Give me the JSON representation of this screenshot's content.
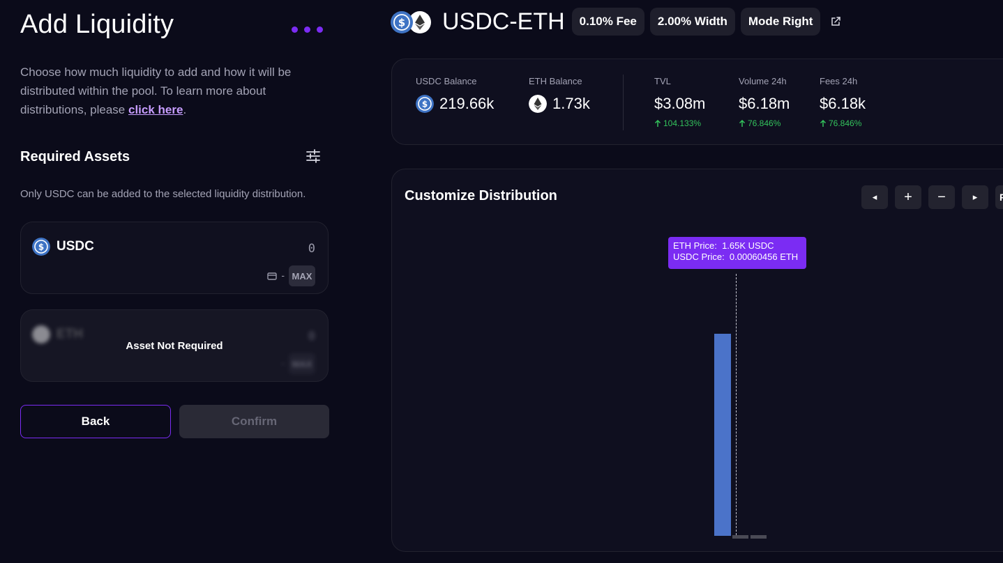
{
  "left": {
    "title": "Add Liquidity",
    "intro_text": "Choose how much liquidity to add and how it will be distributed within the pool. To learn more about distributions, please ",
    "intro_link": "click here",
    "intro_end": ".",
    "section_title": "Required Assets",
    "note": "Only USDC can be added to the selected liquidity distribution.",
    "usdc_card": {
      "symbol": "USDC",
      "amount": "0",
      "wallet_balance": "-",
      "max_label": "MAX"
    },
    "eth_card": {
      "symbol": "ETH",
      "amount": "0",
      "wallet_balance": "-",
      "max_label": "MAX",
      "overlay": "Asset Not Required"
    },
    "back_label": "Back",
    "confirm_label": "Confirm"
  },
  "pool": {
    "name": "USDC-ETH",
    "chips": [
      "0.10% Fee",
      "2.00% Width",
      "Mode Right"
    ]
  },
  "stats": {
    "usdc_balance_label": "USDC Balance",
    "usdc_balance": "219.66k",
    "eth_balance_label": "ETH Balance",
    "eth_balance": "1.73k",
    "tvl_label": "TVL",
    "tvl": "$3.08m",
    "tvl_change": "104.133%",
    "volume_label": "Volume 24h",
    "volume": "$6.18m",
    "volume_change": "76.846%",
    "fees_label": "Fees 24h",
    "fees": "$6.18k",
    "fees_change": "76.846%"
  },
  "distribution": {
    "title": "Customize Distribution",
    "controls": {
      "left": "◂",
      "zoom_in": "+",
      "zoom_out": "−",
      "right": "▸",
      "reset": "Re"
    },
    "tooltip_line1": "ETH Price:  1.65K USDC",
    "tooltip_line2": "USDC Price:  0.00060456 ETH"
  },
  "colors": {
    "accent": "#7b2cf3",
    "bar": "#4b73c9",
    "positive": "#33c35c",
    "usdc": "#3e73c4"
  },
  "icons": [
    "ellipsis-icon",
    "sliders-icon",
    "usdc-icon",
    "eth-icon",
    "wallet-icon",
    "external-link-icon",
    "arrow-up-icon"
  ]
}
